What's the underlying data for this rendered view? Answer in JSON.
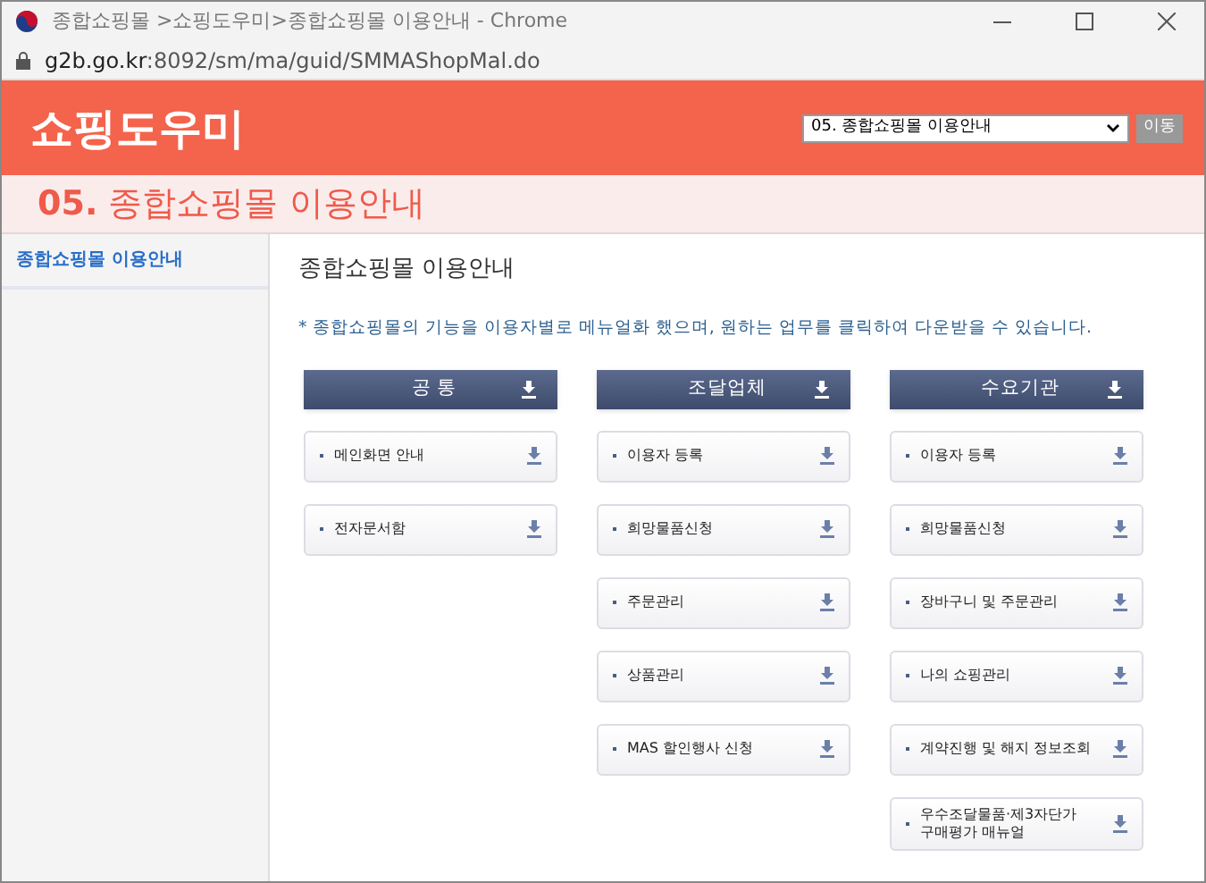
{
  "window": {
    "title": "종합쇼핑몰 >쇼핑도우미>종합쇼핑몰 이용안내 - Chrome"
  },
  "address_bar": {
    "host": "g2b.go.kr",
    "path": ":8092/sm/ma/guid/SMMAShopMal.do"
  },
  "header": {
    "logo": "쇼핑도우미",
    "menu_select": {
      "value": "05. 종합쇼핑몰 이용안내"
    },
    "go_button": "이동"
  },
  "page_title": {
    "number": "05.",
    "text": "종합쇼핑몰 이용안내"
  },
  "sidebar": {
    "items": [
      {
        "label": "종합쇼핑몰 이용안내",
        "selected": true
      }
    ]
  },
  "content": {
    "title": "종합쇼핑몰 이용안내",
    "notice": "* 종합쇼핑몰의 기능을 이용자별로 메뉴얼화 했으며, 원하는 업무를 클릭하여 다운받을 수 있습니다.",
    "columns": [
      {
        "heading": "공 통",
        "items": [
          "메인화면 안내",
          "전자문서함"
        ]
      },
      {
        "heading": "조달업체",
        "items": [
          "이용자 등록",
          "희망물품신청",
          "주문관리",
          "상품관리",
          "MAS 할인행사 신청"
        ]
      },
      {
        "heading": "수요기관",
        "items": [
          "이용자 등록",
          "희망물품신청",
          "장바구니 및 주문관리",
          "나의 쇼핑관리",
          "계약진행 및 해지 정보조회",
          "우수조달물품·제3자단가\n구매평가 매뉴얼"
        ]
      }
    ]
  }
}
